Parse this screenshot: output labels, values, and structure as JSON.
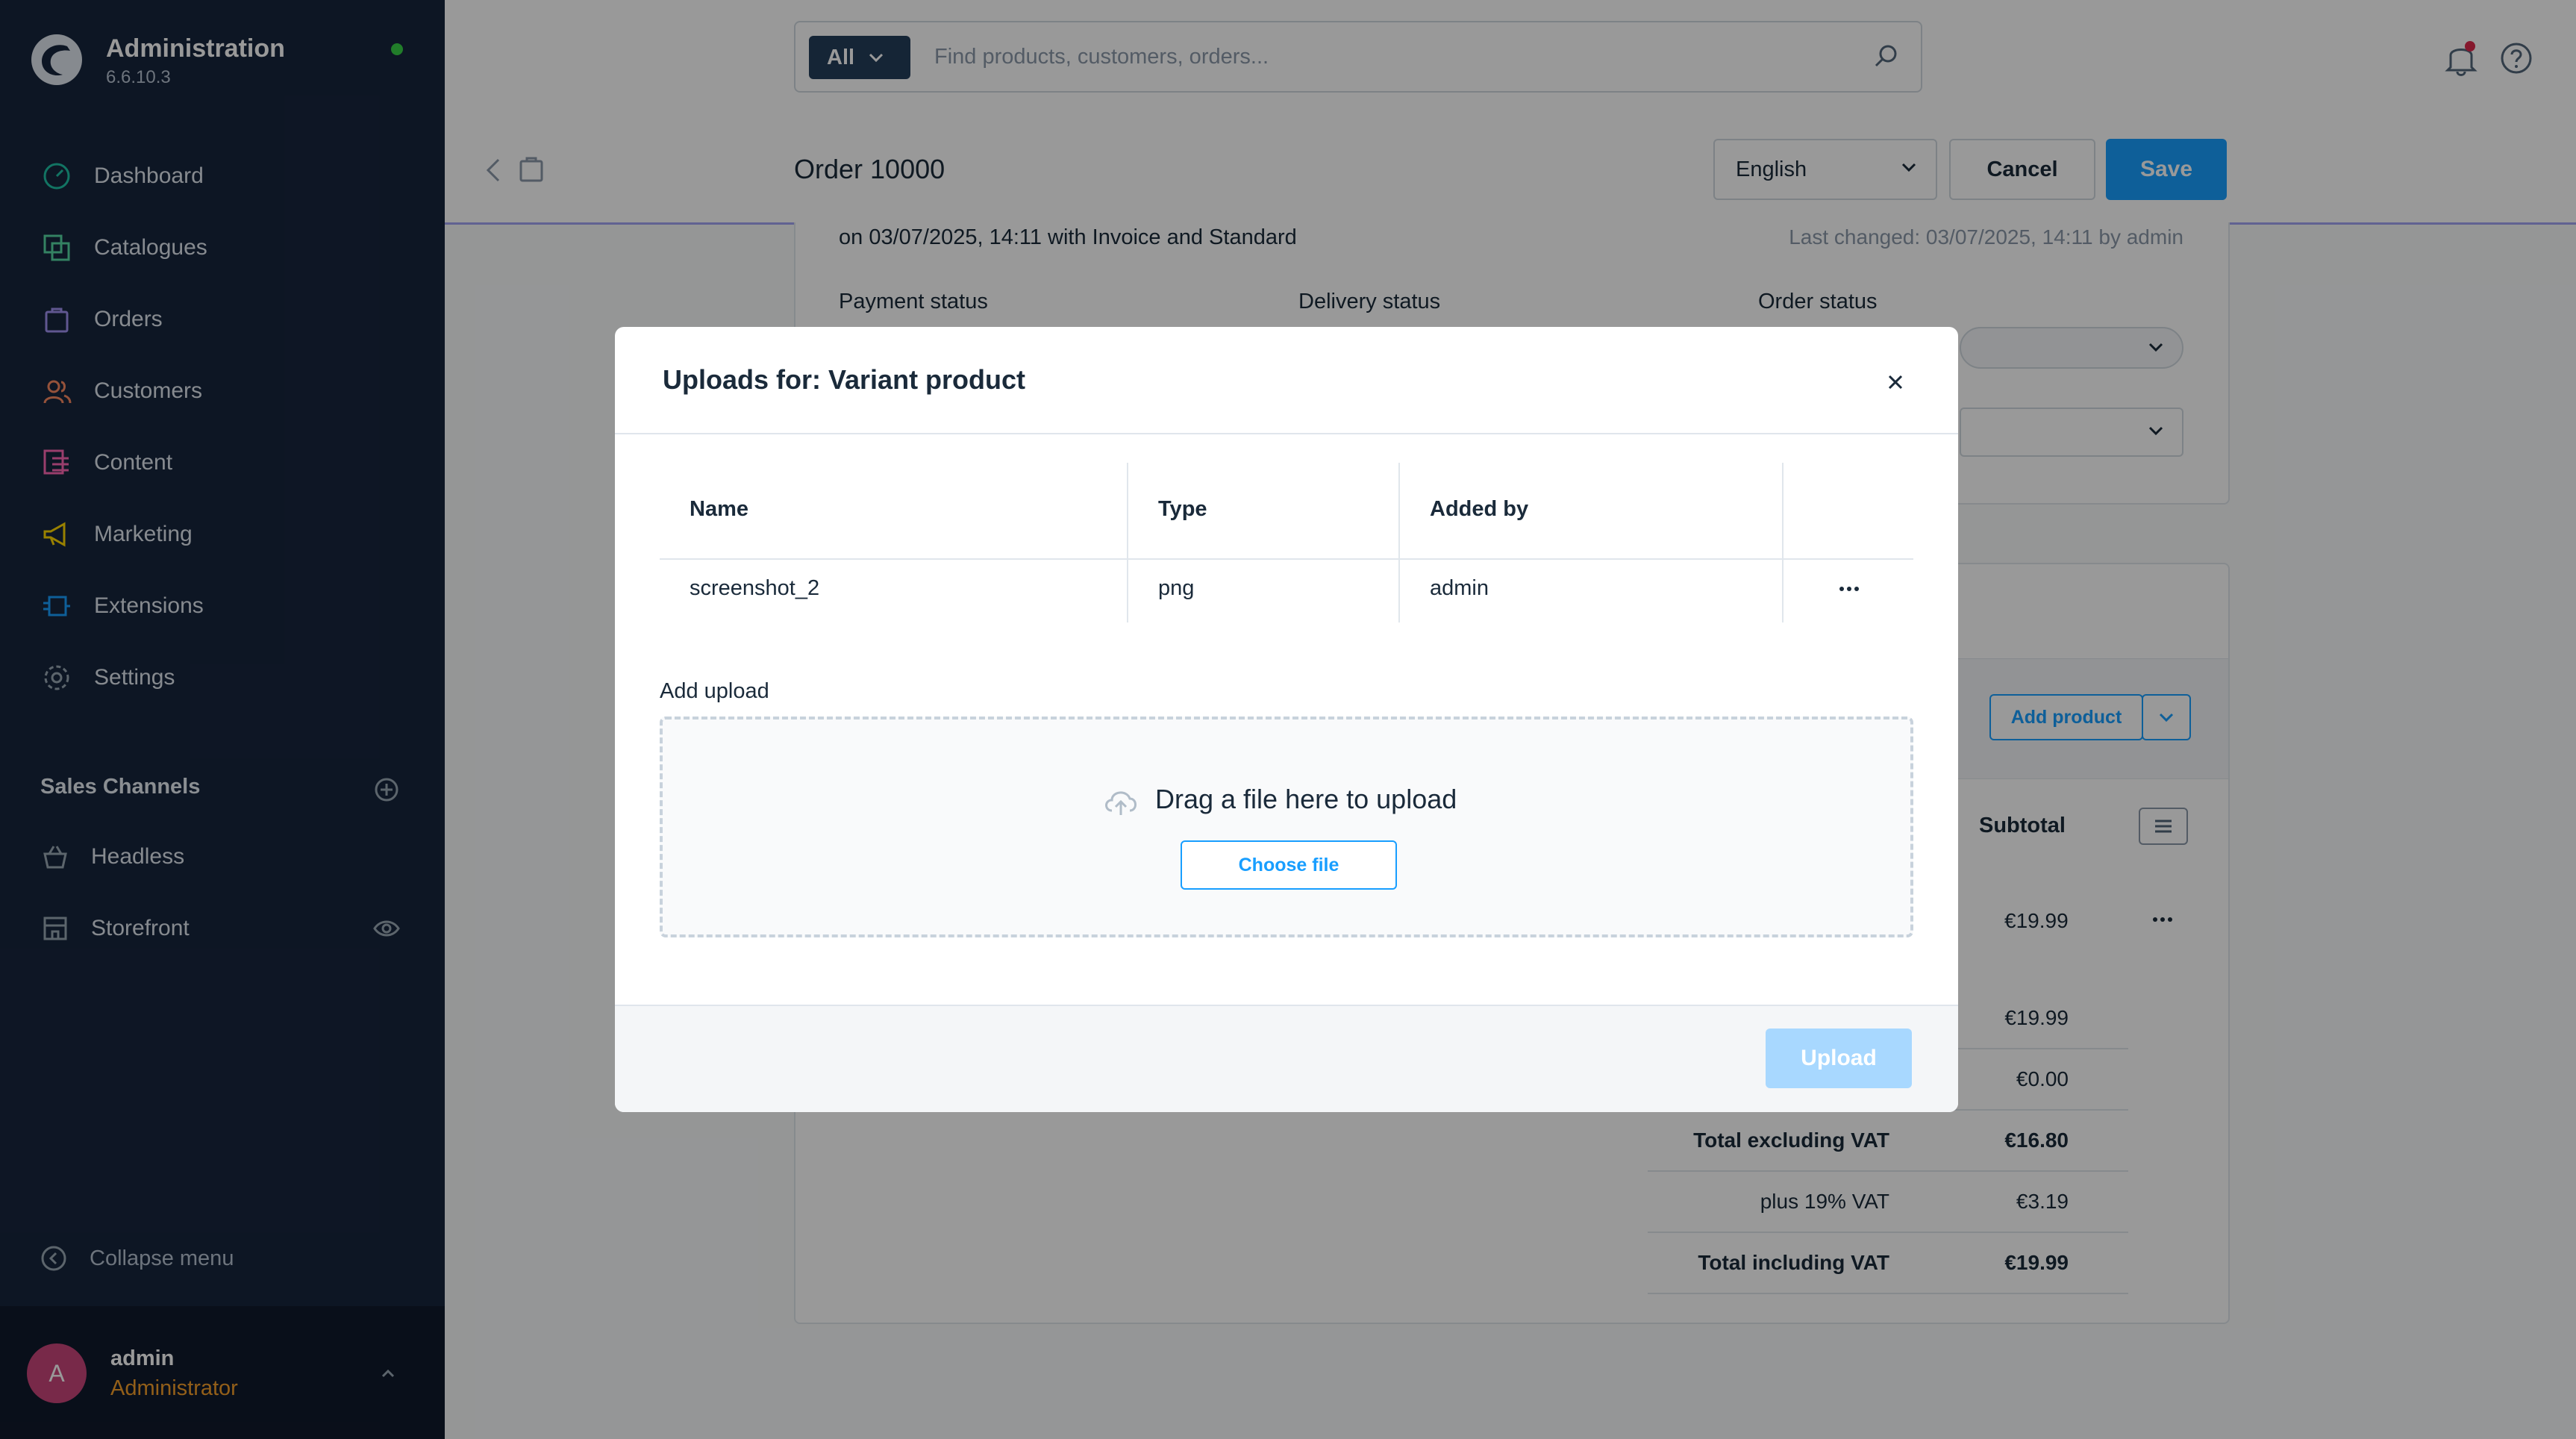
{
  "app": {
    "title": "Administration",
    "version": "6.6.10.3",
    "status_color": "#37d046"
  },
  "sidebar": {
    "items": [
      {
        "label": "Dashboard",
        "icon": "dashboard-icon",
        "color": "#1fc2a6"
      },
      {
        "label": "Catalogues",
        "icon": "catalogue-icon",
        "color": "#57d9a3"
      },
      {
        "label": "Orders",
        "icon": "orders-icon",
        "color": "#a092f0"
      },
      {
        "label": "Customers",
        "icon": "customers-icon",
        "color": "#f88962"
      },
      {
        "label": "Content",
        "icon": "content-icon",
        "color": "#ff68b4"
      },
      {
        "label": "Marketing",
        "icon": "marketing-icon",
        "color": "#ffd700"
      },
      {
        "label": "Extensions",
        "icon": "extensions-icon",
        "color": "#189eff"
      },
      {
        "label": "Settings",
        "icon": "settings-icon",
        "color": "#9aa8b5"
      }
    ],
    "sales_channels_title": "Sales Channels",
    "channels": [
      {
        "label": "Headless",
        "icon": "basket-icon"
      },
      {
        "label": "Storefront",
        "icon": "storefront-icon"
      }
    ],
    "collapse_label": "Collapse menu",
    "user": {
      "initial": "A",
      "name": "admin",
      "role": "Administrator"
    }
  },
  "topbar": {
    "search_scope": "All",
    "search_placeholder": "Find products, customers, orders..."
  },
  "header": {
    "title": "Order 10000",
    "language": "English",
    "cancel_label": "Cancel",
    "save_label": "Save",
    "accent_color": "#189eff"
  },
  "background": {
    "order_info": "on 03/07/2025, 14:11 with Invoice and Standard",
    "last_changed": "Last changed: 03/07/2025, 14:11 by admin",
    "payment_status_label": "Payment status",
    "delivery_status_label": "Delivery status",
    "order_status_label": "Order status",
    "add_product_label": "Add product",
    "subtotal_header": "Subtotal",
    "row_subtotal": "€19.99",
    "totals": [
      {
        "label": "",
        "value": "€19.99",
        "bold": false
      },
      {
        "label": "",
        "value": "€0.00",
        "bold": false
      },
      {
        "label": "Total excluding VAT",
        "value": "€16.80",
        "bold": true
      },
      {
        "label": "plus 19% VAT",
        "value": "€3.19",
        "bold": false
      },
      {
        "label": "Total including VAT",
        "value": "€19.99",
        "bold": true
      }
    ]
  },
  "modal": {
    "title": "Uploads for: Variant product",
    "columns": {
      "name": "Name",
      "type": "Type",
      "added_by": "Added by"
    },
    "rows": [
      {
        "name": "screenshot_2",
        "type": "png",
        "added_by": "admin"
      }
    ],
    "add_upload_label": "Add upload",
    "dropzone_text": "Drag a file here to upload",
    "choose_file_label": "Choose file",
    "upload_label": "Upload"
  }
}
